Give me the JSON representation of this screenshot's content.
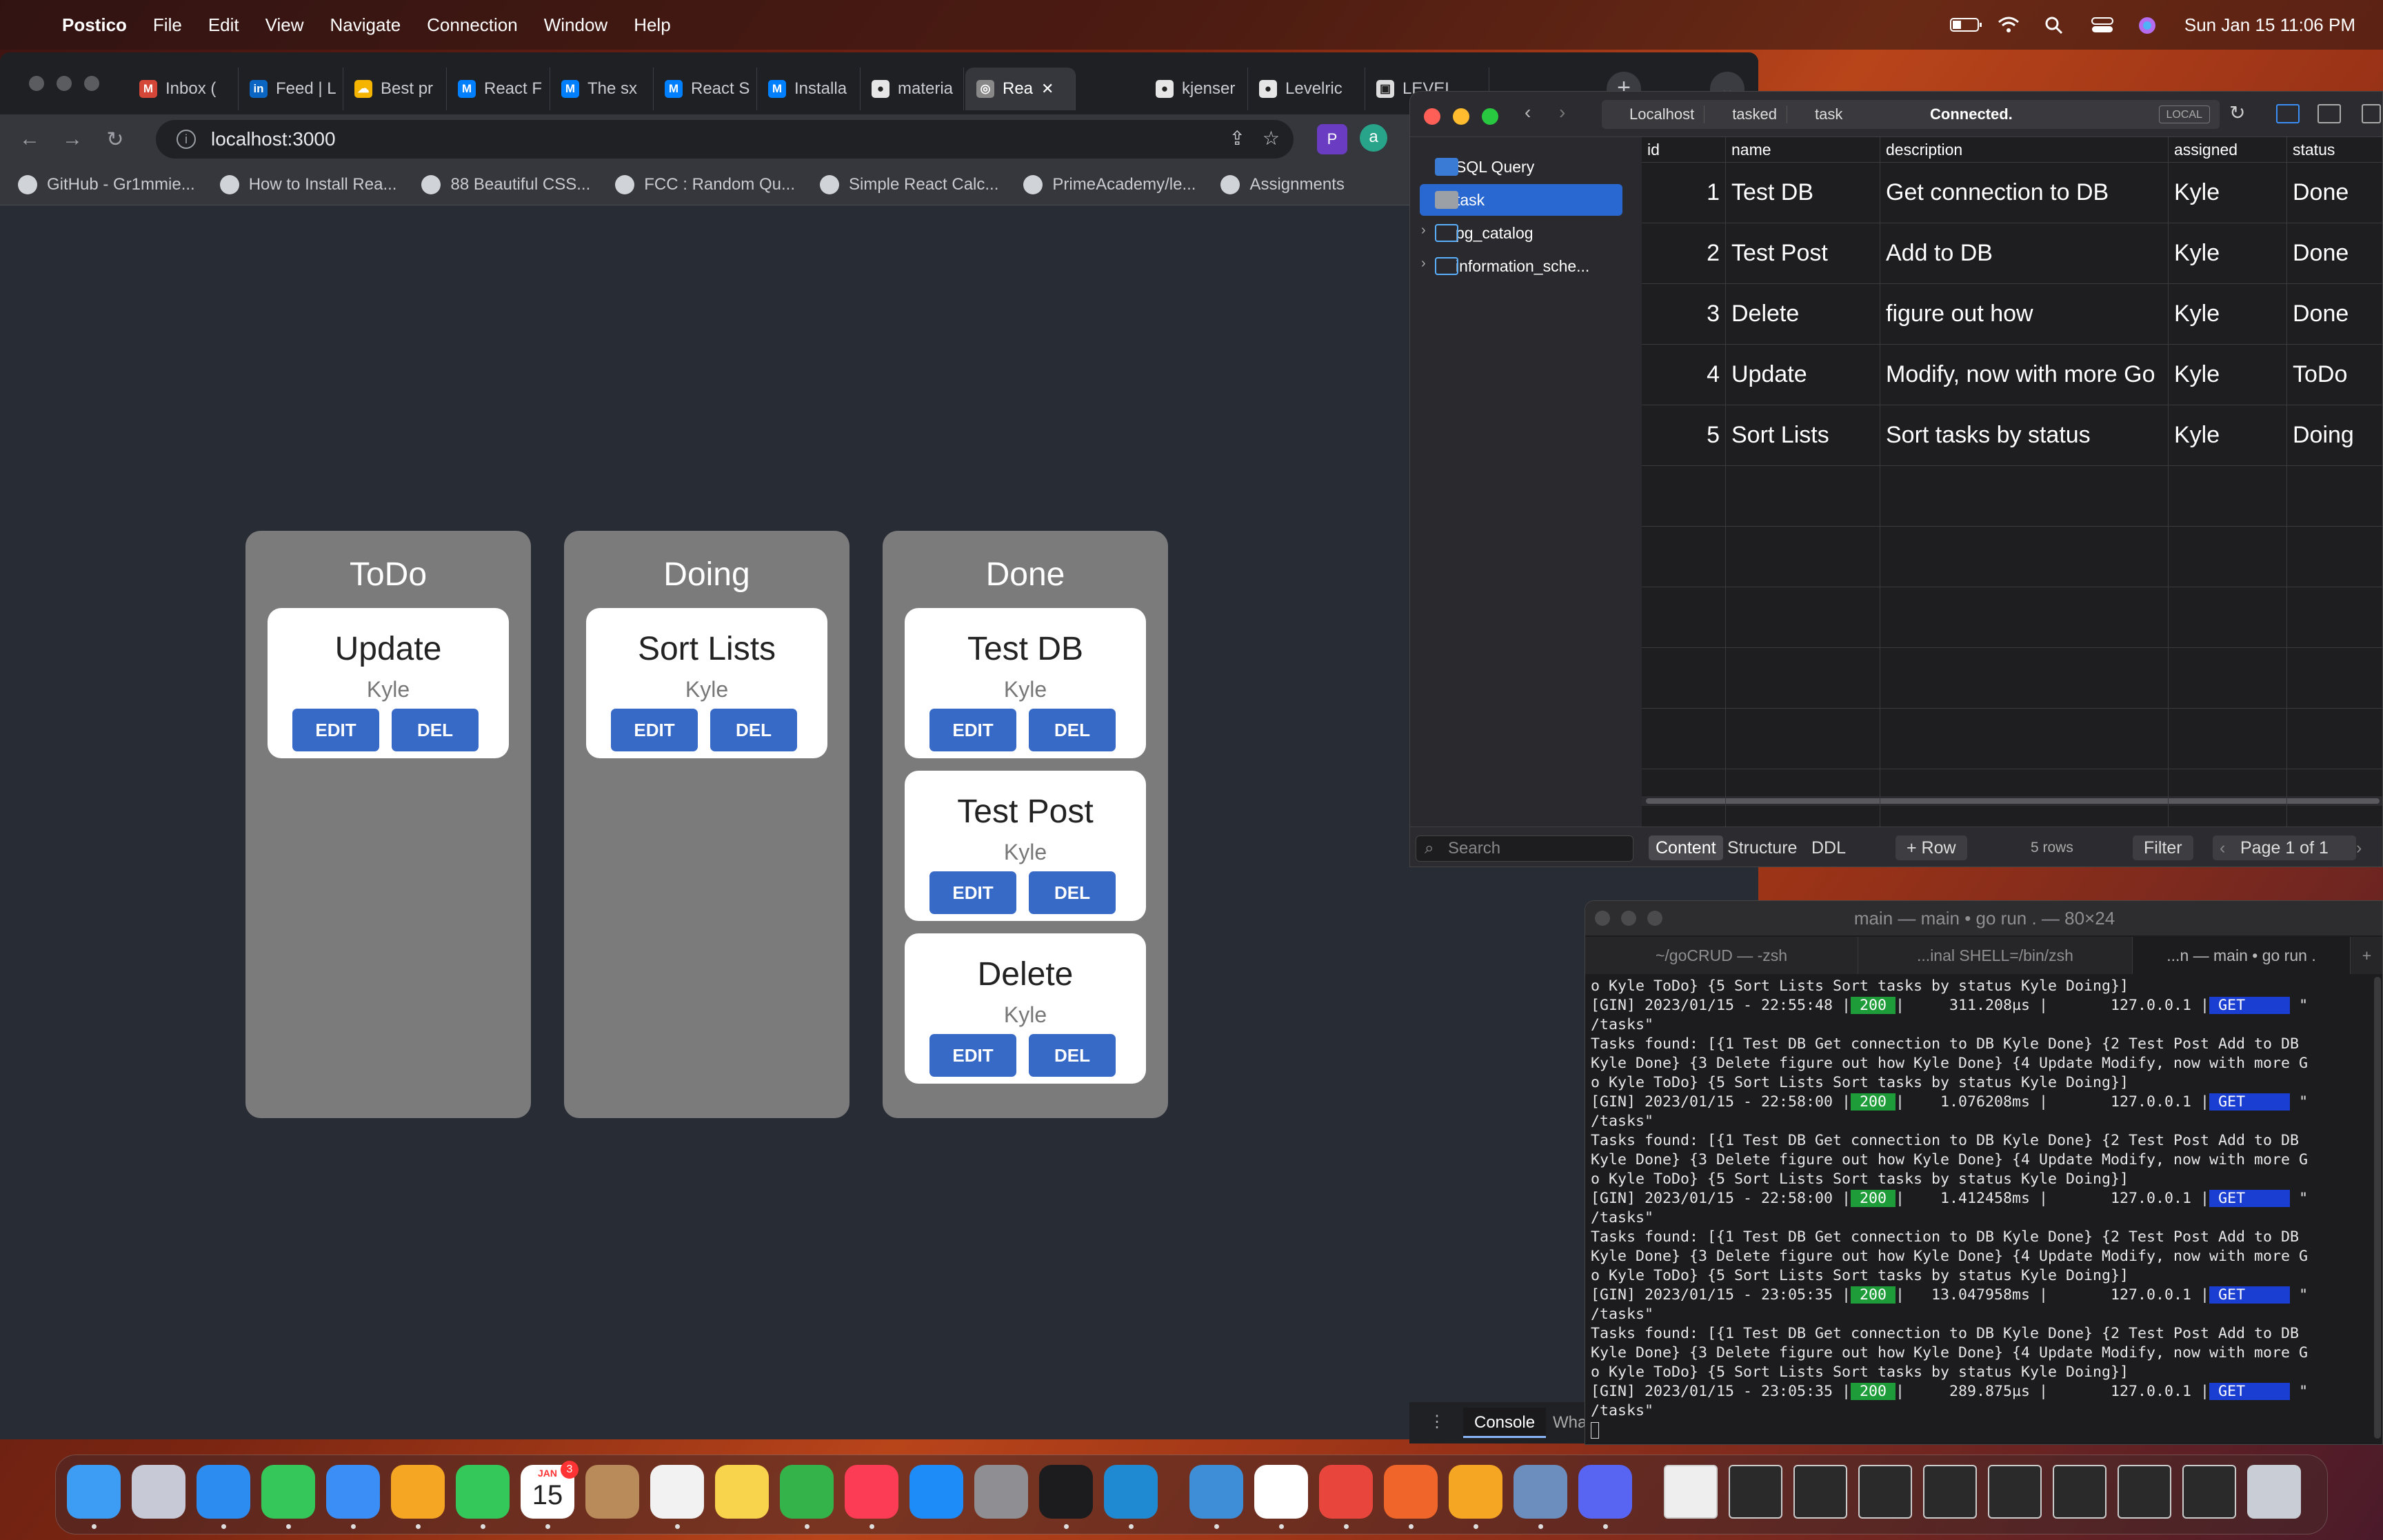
{
  "menubar": {
    "app": "Postico",
    "items": [
      "File",
      "Edit",
      "View",
      "Navigate",
      "Connection",
      "Window",
      "Help"
    ],
    "datetime": "Sun Jan 15  11:06 PM"
  },
  "browser": {
    "tabs": [
      {
        "label": "Inbox (",
        "icon": "gmail-icon",
        "color": "#d44638",
        "glyph": "M"
      },
      {
        "label": "Feed | L",
        "icon": "linkedin-icon",
        "color": "#0a66c2",
        "glyph": "in"
      },
      {
        "label": "Best pr",
        "icon": "google-cloud-icon",
        "color": "#f4b400",
        "glyph": "☁"
      },
      {
        "label": "React F",
        "icon": "mui-icon",
        "color": "#007fff",
        "glyph": "M"
      },
      {
        "label": "The sx",
        "icon": "mui-icon",
        "color": "#007fff",
        "glyph": "M"
      },
      {
        "label": "React S",
        "icon": "mui-icon",
        "color": "#007fff",
        "glyph": "M"
      },
      {
        "label": "Installa",
        "icon": "mui-icon",
        "color": "#007fff",
        "glyph": "M"
      },
      {
        "label": "materia",
        "icon": "github-icon",
        "color": "#e6e6e6",
        "glyph": "●"
      },
      {
        "label": "Rea",
        "icon": "globe-icon",
        "color": "#888",
        "glyph": "◎",
        "active": true
      },
      {
        "label": "kjenser",
        "icon": "github-icon",
        "color": "#e6e6e6",
        "glyph": "●"
      },
      {
        "label": "Levelric",
        "icon": "github-icon",
        "color": "#e6e6e6",
        "glyph": "●"
      },
      {
        "label": "LEVEL",
        "icon": "trello-icon",
        "color": "#ddd",
        "glyph": "▣"
      }
    ],
    "url": "localhost:3000",
    "bookmarks": [
      {
        "label": "GitHub - Gr1mmie...",
        "icon": "github-icon"
      },
      {
        "label": "How to Install Rea...",
        "icon": "article-icon"
      },
      {
        "label": "88 Beautiful CSS...",
        "icon": "cursor-icon"
      },
      {
        "label": "FCC : Random Qu...",
        "icon": "codepen-icon"
      },
      {
        "label": "Simple React Calc...",
        "icon": "codepen-icon"
      },
      {
        "label": "PrimeAcademy/le...",
        "icon": "github-icon"
      },
      {
        "label": "Assignments",
        "icon": "assignments-icon"
      }
    ]
  },
  "kanban": {
    "columns": [
      {
        "title": "ToDo",
        "cards": [
          {
            "name": "Update",
            "assigned": "Kyle"
          }
        ]
      },
      {
        "title": "Doing",
        "cards": [
          {
            "name": "Sort Lists",
            "assigned": "Kyle"
          }
        ]
      },
      {
        "title": "Done",
        "cards": [
          {
            "name": "Test DB",
            "assigned": "Kyle"
          },
          {
            "name": "Test Post",
            "assigned": "Kyle"
          },
          {
            "name": "Delete",
            "assigned": "Kyle"
          }
        ]
      }
    ],
    "edit_label": "EDIT",
    "del_label": "DEL"
  },
  "postico": {
    "breadcrumb": [
      "Localhost",
      "tasked",
      "task"
    ],
    "status": "Connected.",
    "badge": "LOCAL",
    "sidebar": [
      {
        "label": "SQL Query",
        "icon": "sql-icon"
      },
      {
        "label": "task",
        "icon": "table-icon",
        "selected": true
      },
      {
        "label": "pg_catalog",
        "icon": "folder-icon"
      },
      {
        "label": "information_sche...",
        "icon": "folder-icon"
      }
    ],
    "columns": [
      "id",
      "name",
      "description",
      "assigned",
      "status"
    ],
    "rows": [
      [
        "1",
        "Test DB",
        "Get connection to DB",
        "Kyle",
        "Done"
      ],
      [
        "2",
        "Test Post",
        "Add to DB",
        "Kyle",
        "Done"
      ],
      [
        "3",
        "Delete",
        "figure out how",
        "Kyle",
        "Done"
      ],
      [
        "4",
        "Update",
        "Modify, now with more Go",
        "Kyle",
        "ToDo"
      ],
      [
        "5",
        "Sort Lists",
        "Sort tasks by status",
        "Kyle",
        "Doing"
      ]
    ],
    "search_placeholder": "Search",
    "footer": {
      "content": "Content",
      "structure": "Structure",
      "ddl": "DDL",
      "add_row": "+ Row",
      "rows_count": "5 rows",
      "filter": "Filter",
      "page": "Page 1 of 1"
    }
  },
  "devtools": {
    "console": "Console",
    "whats_new": "Wha"
  },
  "terminal": {
    "title": "main — main • go run . — 80×24",
    "tabs": [
      "~/goCRUD — -zsh",
      "...inal SHELL=/bin/zsh",
      "...n — main • go run ."
    ],
    "lines": [
      {
        "t": "text",
        "v": "o Kyle ToDo} {5 Sort Lists Sort tasks by status Kyle Doing}]"
      },
      {
        "t": "gin",
        "pre": "[GIN] 2023/01/15 - 22:55:48 |",
        "code": " 200 ",
        "mid": "|     311.208µs |       127.0.0.1 |",
        "method": " GET     ",
        "post": " \""
      },
      {
        "t": "text",
        "v": "/tasks\""
      },
      {
        "t": "text",
        "v": "Tasks found: [{1 Test DB Get connection to DB Kyle Done} {2 Test Post Add to DB"
      },
      {
        "t": "text",
        "v": "Kyle Done} {3 Delete figure out how Kyle Done} {4 Update Modify, now with more G"
      },
      {
        "t": "text",
        "v": "o Kyle ToDo} {5 Sort Lists Sort tasks by status Kyle Doing}]"
      },
      {
        "t": "gin",
        "pre": "[GIN] 2023/01/15 - 22:58:00 |",
        "code": " 200 ",
        "mid": "|    1.076208ms |       127.0.0.1 |",
        "method": " GET     ",
        "post": " \""
      },
      {
        "t": "text",
        "v": "/tasks\""
      },
      {
        "t": "text",
        "v": "Tasks found: [{1 Test DB Get connection to DB Kyle Done} {2 Test Post Add to DB"
      },
      {
        "t": "text",
        "v": "Kyle Done} {3 Delete figure out how Kyle Done} {4 Update Modify, now with more G"
      },
      {
        "t": "text",
        "v": "o Kyle ToDo} {5 Sort Lists Sort tasks by status Kyle Doing}]"
      },
      {
        "t": "gin",
        "pre": "[GIN] 2023/01/15 - 22:58:00 |",
        "code": " 200 ",
        "mid": "|    1.412458ms |       127.0.0.1 |",
        "method": " GET     ",
        "post": " \""
      },
      {
        "t": "text",
        "v": "/tasks\""
      },
      {
        "t": "text",
        "v": "Tasks found: [{1 Test DB Get connection to DB Kyle Done} {2 Test Post Add to DB"
      },
      {
        "t": "text",
        "v": "Kyle Done} {3 Delete figure out how Kyle Done} {4 Update Modify, now with more G"
      },
      {
        "t": "text",
        "v": "o Kyle ToDo} {5 Sort Lists Sort tasks by status Kyle Doing}]"
      },
      {
        "t": "gin",
        "pre": "[GIN] 2023/01/15 - 23:05:35 |",
        "code": " 200 ",
        "mid": "|   13.047958ms |       127.0.0.1 |",
        "method": " GET     ",
        "post": " \""
      },
      {
        "t": "text",
        "v": "/tasks\""
      },
      {
        "t": "text",
        "v": "Tasks found: [{1 Test DB Get connection to DB Kyle Done} {2 Test Post Add to DB"
      },
      {
        "t": "text",
        "v": "Kyle Done} {3 Delete figure out how Kyle Done} {4 Update Modify, now with more G"
      },
      {
        "t": "text",
        "v": "o Kyle ToDo} {5 Sort Lists Sort tasks by status Kyle Doing}]"
      },
      {
        "t": "gin",
        "pre": "[GIN] 2023/01/15 - 23:05:35 |",
        "code": " 200 ",
        "mid": "|     289.875µs |       127.0.0.1 |",
        "method": " GET     ",
        "post": " \""
      },
      {
        "t": "text",
        "v": "/tasks\""
      }
    ]
  },
  "dock": {
    "calendar_day": "15",
    "calendar_month": "JAN",
    "calendar_badge": "3",
    "apps": [
      {
        "name": "finder-icon",
        "color": "#3d9df5"
      },
      {
        "name": "launchpad-icon",
        "color": "#c7c9d6"
      },
      {
        "name": "safari-icon",
        "color": "#2d8cf0"
      },
      {
        "name": "messages-icon",
        "color": "#35c759"
      },
      {
        "name": "mail-icon",
        "color": "#3a8ef6"
      },
      {
        "name": "photos-icon",
        "color": "#f5a623"
      },
      {
        "name": "facetime-icon",
        "color": "#34c759"
      },
      {
        "name": "calendar-icon",
        "color": "#ffffff"
      },
      {
        "name": "contacts-icon",
        "color": "#b98a5a"
      },
      {
        "name": "reminders-icon",
        "color": "#f2f2f2"
      },
      {
        "name": "notes-icon",
        "color": "#f7d44c"
      },
      {
        "name": "numbers-icon",
        "color": "#33b34a"
      },
      {
        "name": "music-icon",
        "color": "#fb3c54"
      },
      {
        "name": "app-store-icon",
        "color": "#1d8cf8"
      },
      {
        "name": "system-settings-icon",
        "color": "#8e8e93"
      },
      {
        "name": "terminal-icon",
        "color": "#1c1c1e"
      },
      {
        "name": "vscode-icon",
        "color": "#1f8ad2"
      },
      {
        "name": "postico-icon",
        "color": "#3d8ed6"
      },
      {
        "name": "slack-icon",
        "color": "#ffffff"
      },
      {
        "name": "chrome-icon",
        "color": "#e8453c"
      },
      {
        "name": "pencil-icon",
        "color": "#f06529"
      },
      {
        "name": "pages-icon",
        "color": "#f5a623"
      },
      {
        "name": "preview-icon",
        "color": "#6c8ebf"
      },
      {
        "name": "discord-icon",
        "color": "#5865f2"
      }
    ],
    "docs": [
      "document-icon",
      "screenshot-icon",
      "screenshot-icon",
      "screenshot-icon",
      "screenshot-icon",
      "screenshot-icon",
      "screenshot-icon",
      "screenshot-icon",
      "screenshot-icon"
    ]
  }
}
